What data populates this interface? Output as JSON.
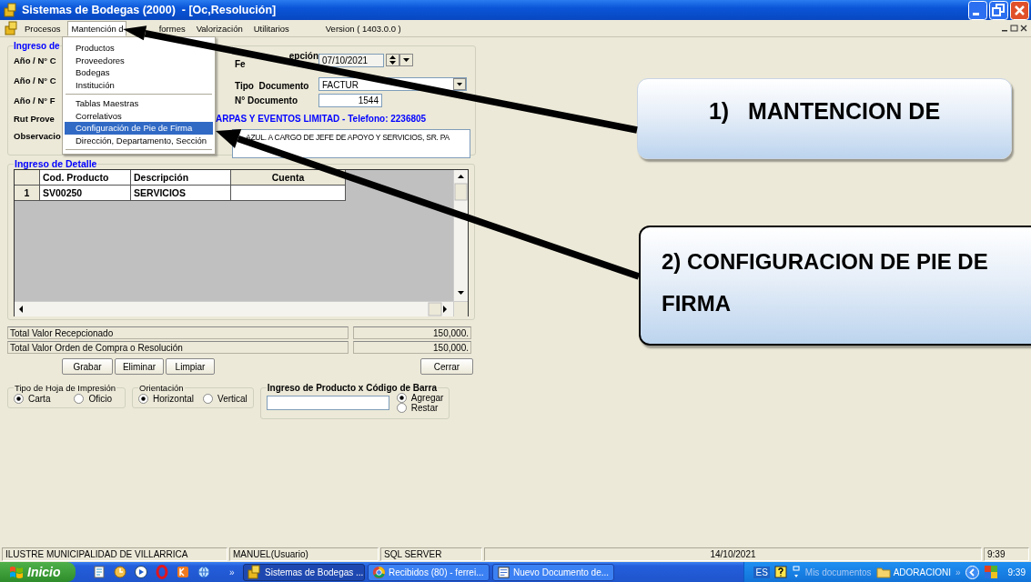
{
  "window": {
    "title": "Sistemas de Bodegas (2000)  - [Oc,Resolución]"
  },
  "menu_bar": {
    "items": [
      {
        "label": "Procesos",
        "selected": false
      },
      {
        "label": "Mantención d",
        "selected": true
      },
      {
        "label": "formes",
        "selected": false
      },
      {
        "label": "Valorización",
        "selected": false
      },
      {
        "label": "Utilitarios",
        "selected": false
      }
    ],
    "version": "Version ( 1403.0.0 )"
  },
  "dropdown_menu": {
    "groups": [
      [
        {
          "label": "Productos",
          "selected": false
        },
        {
          "label": "Proveedores",
          "selected": false
        },
        {
          "label": "Bodegas",
          "selected": false
        },
        {
          "label": "Institución",
          "selected": false
        }
      ],
      [
        {
          "label": "Tablas Maestras",
          "selected": false
        },
        {
          "label": "Correlativos",
          "selected": false
        },
        {
          "label": "Configuración de Pie de Firma",
          "selected": true
        },
        {
          "label": "Dirección, Departamento, Sección",
          "selected": false
        }
      ]
    ]
  },
  "header_group": {
    "title": "Ingreso de",
    "rows": [
      {
        "label": "Año / N° C",
        "field_label_parts": [
          "Fe",
          "epción"
        ],
        "kind": "date",
        "value": "07/10/2021"
      },
      {
        "label": "Año / N° C",
        "field_label_parts": [
          "Tipo  Documento"
        ],
        "kind": "select",
        "value": "FACTUR"
      },
      {
        "label": "Año / N° F",
        "field_label_parts": [
          "N° Documento"
        ],
        "kind": "number",
        "value": "1544"
      },
      {
        "label": "Rut Prove",
        "kind": "info",
        "value": "ARPAS Y EVENTOS LIMITAD - Telefono: 2236805"
      },
      {
        "label": "Observacio",
        "kind": "memo",
        "value": "AZUL. A CARGO DE JEFE DE APOYO Y SERVICIOS, SR. PA"
      }
    ]
  },
  "detail_group": {
    "title": "Ingreso de Detalle",
    "table": {
      "columns": [
        "Cod. Producto",
        "Descripción",
        "Cuenta"
      ],
      "rows": [
        {
          "number": "1",
          "cells": [
            "SV00250",
            "SERVICIOS"
          ]
        }
      ]
    }
  },
  "totals": [
    {
      "label": "Total Valor Recepcionado",
      "value": "150,000."
    },
    {
      "label": "Total Valor Orden de Compra o Resolución",
      "value": "150,000."
    }
  ],
  "buttons": [
    "Grabar",
    "Eliminar",
    "Limpiar"
  ],
  "close_button": "Cerrar",
  "option_groups": [
    {
      "title": "Tipo de Hoja de Impresión",
      "kind": "radios",
      "options": [
        {
          "label": "Carta",
          "selected": true
        },
        {
          "label": "Oficio",
          "selected": false
        }
      ]
    },
    {
      "title": "Orientación",
      "kind": "radios",
      "options": [
        {
          "label": "Horizontal",
          "selected": true
        },
        {
          "label": "Vertical",
          "selected": false
        }
      ]
    },
    {
      "title": "Ingreso de Producto x Código de Barra",
      "kind": "barcode",
      "options": [
        {
          "label": "Agregar",
          "selected": true
        },
        {
          "label": "Restar",
          "selected": false
        }
      ]
    }
  ],
  "callouts": [
    {
      "text": "1)   MANTENCION DE",
      "kind": "soft"
    },
    {
      "text": "2) CONFIGURACION DE PIE DE FIRMA",
      "kind": "outlined"
    }
  ],
  "status_bar": [
    "ILUSTRE MUNICIPALIDAD DE VILLARRICA",
    "MANUEL(Usuario)",
    "SQL SERVER",
    "14/10/2021",
    "9:39"
  ],
  "taskbar": {
    "start": "Inicio",
    "more": "»",
    "tasks": [
      {
        "label": "Sistemas de Bodegas ...",
        "selected": true
      },
      {
        "label": "Recibidos (80) - ferrei...",
        "selected": false
      },
      {
        "label": "Nuevo Documento de...",
        "selected": false
      }
    ],
    "language": "ES",
    "toolbar": "Mis documentos",
    "folder": "ADORACIONI",
    "tray_more": "»",
    "clock": "9:39"
  }
}
